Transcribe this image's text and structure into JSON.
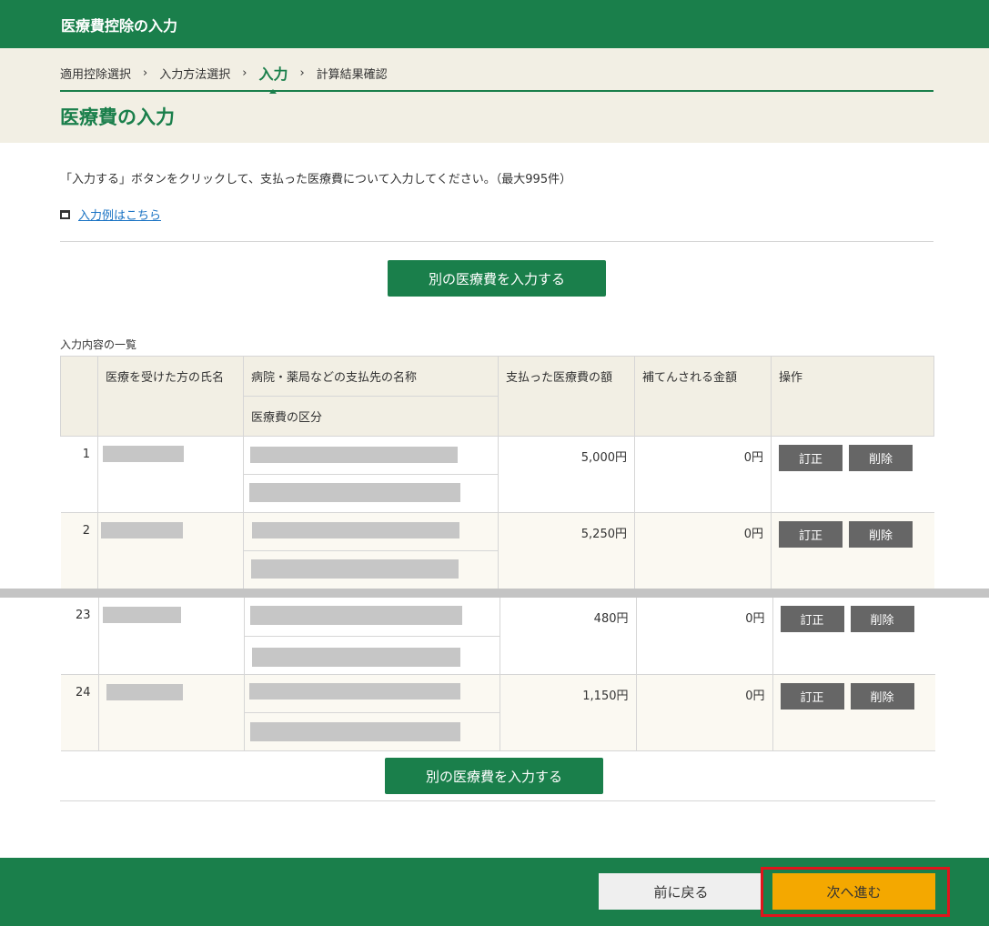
{
  "header": {
    "title": "医療費控除の入力"
  },
  "steps": {
    "items": [
      "適用控除選択",
      "入力方法選択",
      "入力",
      "計算結果確認"
    ],
    "separator": "›"
  },
  "page_title": "医療費の入力",
  "intro_text": "「入力する」ボタンをクリックして、支払った医療費について入力してください。（最大995件）",
  "example_link": "入力例はこちら",
  "add_button": "別の医療費を入力する",
  "list_label": "入力内容の一覧",
  "table": {
    "headers": {
      "name": "医療を受けた方の氏名",
      "payee": "病院・薬局などの支払先の名称",
      "category": "医療費の区分",
      "paid": "支払った医療費の額",
      "reimbursed": "補てんされる金額",
      "ops": "操作"
    },
    "rows_top": [
      {
        "no": "1",
        "paid": "5,000円",
        "reimbursed": "0円"
      },
      {
        "no": "2",
        "paid": "5,250円",
        "reimbursed": "0円"
      }
    ],
    "rows_bottom": [
      {
        "no": "23",
        "paid": "480円",
        "reimbursed": "0円"
      },
      {
        "no": "24",
        "paid": "1,150円",
        "reimbursed": "0円"
      }
    ],
    "edit_label": "訂正",
    "delete_label": "削除"
  },
  "footer": {
    "back_label": "前に戻る",
    "next_label": "次へ進む"
  },
  "colors": {
    "primary_green": "#1a7f4b",
    "beige": "#f2efe4",
    "next_yellow": "#f4a800",
    "highlight_red": "#e0151c",
    "link_blue": "#1a73c4"
  }
}
